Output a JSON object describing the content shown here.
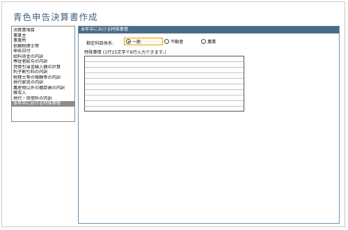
{
  "app": {
    "title": "青色申告決算書作成"
  },
  "sidebar": {
    "items": [
      {
        "label": "決算書項目",
        "selected": false
      },
      {
        "label": "事業主",
        "selected": false
      },
      {
        "label": "事業所",
        "selected": false
      },
      {
        "label": "依頼税理士等",
        "selected": false
      },
      {
        "label": "申告日付",
        "selected": false
      },
      {
        "label": "給料賃金の内訳",
        "selected": false
      },
      {
        "label": "専従者給与の内訳",
        "selected": false
      },
      {
        "label": "貸倒引当金繰入額の計算",
        "selected": false
      },
      {
        "label": "利子割引料の内訳",
        "selected": false
      },
      {
        "label": "税理士等の報酬等の内訳",
        "selected": false
      },
      {
        "label": "地代家賃の内訳",
        "selected": false
      },
      {
        "label": "農産物以外の棚卸高の内訳",
        "selected": false
      },
      {
        "label": "雑収入",
        "selected": false
      },
      {
        "label": "地代・賃借料の内訳",
        "selected": false
      },
      {
        "label": "本年中における特殊事情",
        "selected": true
      }
    ]
  },
  "panel": {
    "header": "本年中における特殊事情",
    "field_label": "勘定科目体系:",
    "options": [
      {
        "label": "一般",
        "checked": true,
        "focused": true
      },
      {
        "label": "不動産",
        "checked": false,
        "focused": false
      },
      {
        "label": "農業",
        "checked": false,
        "focused": false
      }
    ],
    "notes_label": "特殊事情 (1行15文字で6行入力できます。)",
    "notes_value": ""
  }
}
